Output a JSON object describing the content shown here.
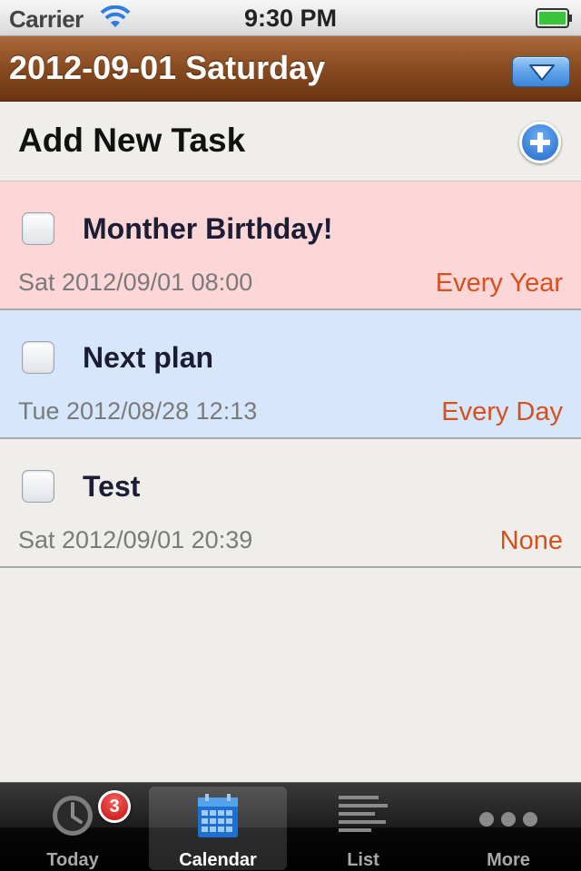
{
  "status_bar": {
    "carrier": "Carrier",
    "time": "9:30 PM",
    "wifi_icon": "wifi-icon",
    "battery_icon": "battery-icon",
    "battery_color": "#3cc33c"
  },
  "header": {
    "title": "2012-09-01 Saturday",
    "dropdown_icon": "triangle-down-icon"
  },
  "add_task": {
    "label": "Add New Task",
    "icon": "plus-circle-icon",
    "accent": "#2a74d6"
  },
  "tasks": [
    {
      "title": "Monther Birthday!",
      "datetime": "Sat 2012/09/01 08:00",
      "repeat": "Every Year",
      "background": "#fdd6d7"
    },
    {
      "title": "Next plan",
      "datetime": "Tue 2012/08/28 12:13",
      "repeat": "Every Day",
      "background": "#d6e6fb"
    },
    {
      "title": "Test",
      "datetime": "Sat 2012/09/01 20:39",
      "repeat": "None",
      "background": "#efeeea"
    }
  ],
  "tab_bar": {
    "tabs": [
      {
        "label": "Today",
        "icon": "clock-icon",
        "badge": "3",
        "active": false
      },
      {
        "label": "Calendar",
        "icon": "calendar-icon",
        "active": true
      },
      {
        "label": "List",
        "icon": "list-icon",
        "active": false
      },
      {
        "label": "More",
        "icon": "more-icon",
        "active": false
      }
    ]
  },
  "colors": {
    "repeat_text": "#d8501e",
    "header_brown": "#8b4d22"
  }
}
